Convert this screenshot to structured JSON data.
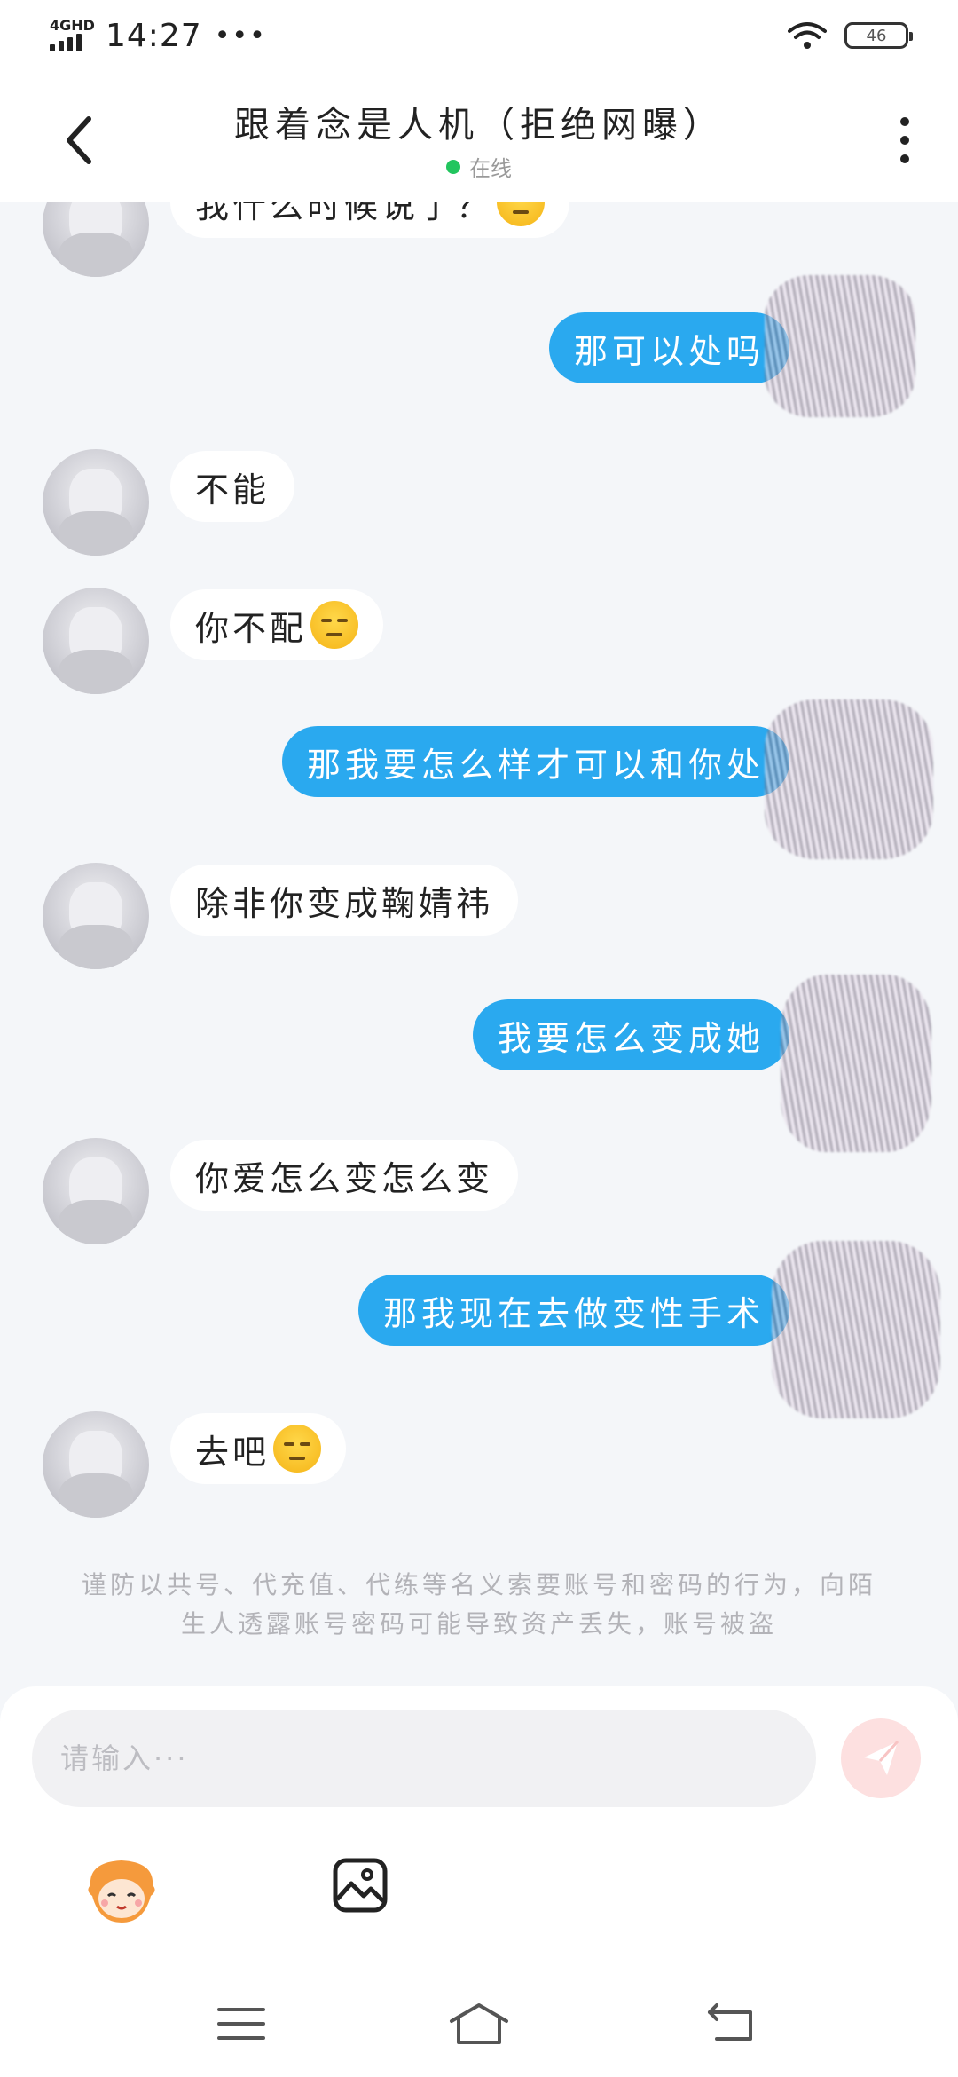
{
  "status_bar": {
    "network": "4GHD",
    "time": "14:27",
    "more_dots": "•••",
    "battery": "46"
  },
  "header": {
    "title": "跟着念是人机（拒绝网曝）",
    "status": "在线"
  },
  "messages": [
    {
      "side": "left",
      "text": "我什么时候说了？",
      "emoji": "unamused-face"
    },
    {
      "side": "right",
      "text": "那可以处吗"
    },
    {
      "side": "left",
      "text": "不能"
    },
    {
      "side": "left",
      "text": "你不配",
      "emoji": "unamused-face"
    },
    {
      "side": "right",
      "text": "那我要怎么样才可以和你处"
    },
    {
      "side": "left",
      "text": "除非你变成鞠婧祎"
    },
    {
      "side": "right",
      "text": "我要怎么变成她"
    },
    {
      "side": "left",
      "text": "你爱怎么变怎么变"
    },
    {
      "side": "right",
      "text": "那我现在去做变性手术"
    },
    {
      "side": "left",
      "text": "去吧",
      "emoji": "unamused-face"
    }
  ],
  "notice": "谨防以共号、代充值、代练等名义索要账号和密码的行为，向陌生人透露账号密码可能导致资产丢失，账号被盗",
  "composer": {
    "placeholder": "请输入···",
    "send_icon": "paper-plane-icon",
    "sticker_icon": "sticker-icon",
    "image_icon": "image-icon"
  },
  "nav": {
    "menu_icon": "menu-icon",
    "home_icon": "home-icon",
    "back_icon": "back-icon"
  },
  "colors": {
    "accent": "#2aa9ef",
    "online": "#22c55e",
    "background": "#f4f6f9"
  }
}
